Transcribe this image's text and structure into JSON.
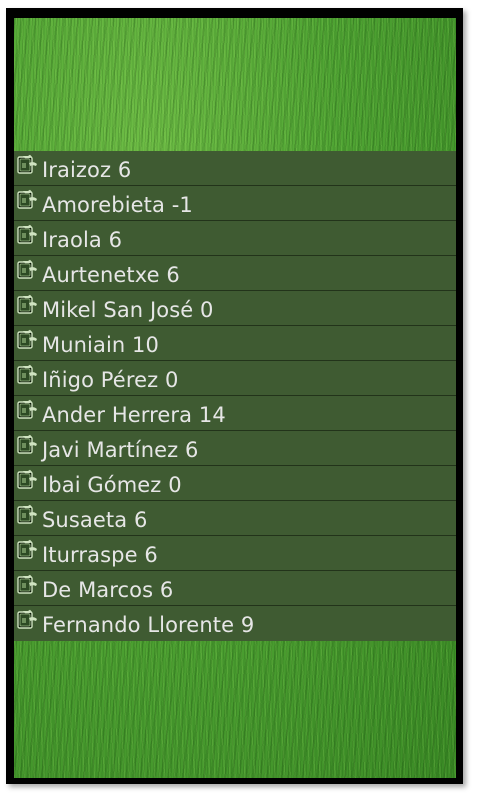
{
  "colors": {
    "row_background": "#3f5b32",
    "row_divider": "#22331a",
    "text": "#e6e6e6",
    "grass": "#4fa433"
  },
  "list": {
    "icon": "boot-icon",
    "items": [
      {
        "label": "Iraizoz 6"
      },
      {
        "label": "Amorebieta -1"
      },
      {
        "label": "Iraola 6"
      },
      {
        "label": "Aurtenetxe 6"
      },
      {
        "label": "Mikel San José 0"
      },
      {
        "label": "Muniain 10"
      },
      {
        "label": "Iñigo Pérez 0"
      },
      {
        "label": "Ander Herrera 14"
      },
      {
        "label": "Javi Martínez 6"
      },
      {
        "label": "Ibai Gómez 0"
      },
      {
        "label": "Susaeta 6"
      },
      {
        "label": "Iturraspe 6"
      },
      {
        "label": "De Marcos 6"
      },
      {
        "label": "Fernando Llorente 9"
      }
    ]
  }
}
